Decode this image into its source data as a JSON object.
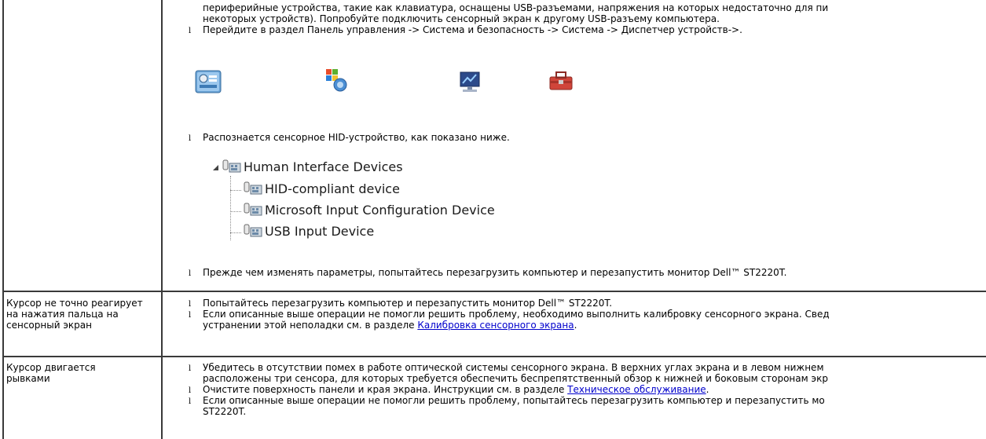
{
  "row1": {
    "cont_line1": "периферийные устройства, такие как клавиатура, оснащены USB-разъемами, напряжения на которых недостаточно для пи",
    "cont_line2": "некоторых устройств). Попробуйте подключить сенсорный экран к другому USB-разъему компьютера.",
    "bullet_mark": "l",
    "bullet1": "Перейдите в раздел Панель управления -> Система и безопасность -> Система -> Диспетчер устройств->.",
    "icons": [
      "control-panel-icon",
      "security-shield-icon",
      "system-monitor-icon",
      "device-manager-toolbox-icon"
    ],
    "bullet2": "Распознается сенсорное HID-устройство, как показано ниже.",
    "tree": {
      "root": "Human Interface Devices",
      "children": [
        "HID-compliant device",
        "Microsoft Input Configuration Device",
        "USB Input Device"
      ]
    },
    "bullet3": "Прежде чем изменять параметры, попытайтесь перезагрузить компьютер и перезапустить монитор Dell™ ST2220T."
  },
  "row2": {
    "problem": "Курсор не точно реагирует на нажатия пальца на сенсорный экран",
    "bullet1": "Попытайтесь перезагрузить компьютер и перезапустить монитор Dell™ ST2220T.",
    "bullet2_line1": "Если описанные выше операции не помогли решить проблему, необходимо выполнить калибровку сенсорного экрана. Свед",
    "bullet2_line2_pre": "устранении этой неполадки см. в разделе ",
    "bullet2_link": "Калибровка сенсорного экрана",
    "bullet2_line2_post": "."
  },
  "row3": {
    "problem": "Курсор двигается рывками",
    "bullet1_line1": "Убедитесь в отсутствии помех в работе оптической системы сенсорного экрана. В верхних углах экрана и в левом нижнем",
    "bullet1_line2": "расположены три сенсора, для которых требуется обеспечить беспрепятственный обзор к нижней и боковым сторонам экр",
    "bullet2_pre": "Очистите поверхность панели и края экрана. Инструкции см. в разделе ",
    "bullet2_link": "Техническое обслуживание",
    "bullet2_post": ".",
    "bullet3_line1": "Если описанные выше операции не помогли решить проблему, попытайтесь перезагрузить компьютер и перезапустить мо",
    "bullet3_line2": "ST2220T."
  }
}
